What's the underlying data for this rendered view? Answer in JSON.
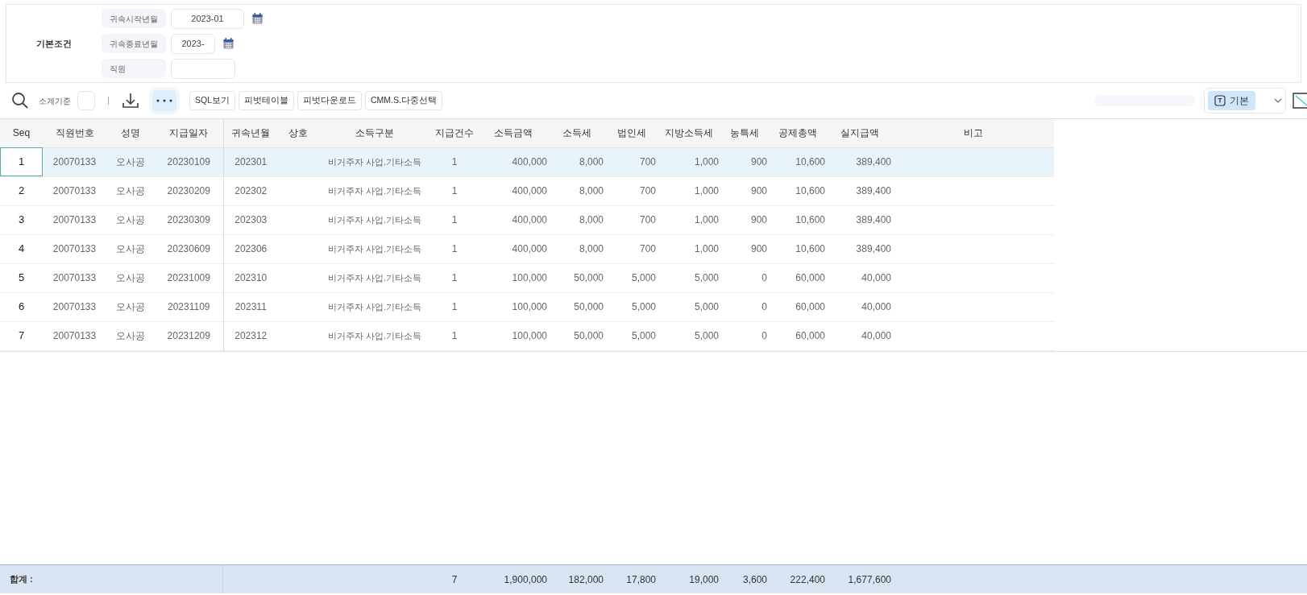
{
  "filter_panel": {
    "title": "기본조건",
    "fields": [
      {
        "label": "귀속시작년월",
        "value": "2023-01",
        "kind": "month"
      },
      {
        "label": "귀속종료년월",
        "value": "2023-",
        "kind": "month"
      },
      {
        "label": "직원",
        "kind": "text"
      }
    ]
  },
  "toolbar": {
    "subtotal_label": "소계기준",
    "subtotal_checked": false,
    "more_selected": true,
    "buttons": [
      "SQL보기",
      "피벗테이블",
      "피벗다운로드",
      "CMM.S.다중선택"
    ],
    "view_select": "기본"
  },
  "table": {
    "columns": [
      "Seq",
      "직원번호",
      "성명",
      "지급일자",
      "귀속년월",
      "상호",
      "소득구분",
      "지급건수",
      "소득금액",
      "소득세",
      "법인세",
      "지방소득세",
      "농특세",
      "공제총액",
      "실지급액",
      "비고"
    ],
    "rows": [
      {
        "selected": true,
        "cells": [
          "1",
          "20070133",
          "오사공",
          "20230109",
          "202301",
          null,
          "비거주자 사업.기타소득",
          "1",
          "400,000",
          "8,000",
          "700",
          "1,000",
          "900",
          "10,600",
          "389,400",
          null
        ]
      },
      {
        "selected": false,
        "cells": [
          "2",
          "20070133",
          "오사공",
          "20230209",
          "202302",
          null,
          "비거주자 사업.기타소득",
          "1",
          "400,000",
          "8,000",
          "700",
          "1,000",
          "900",
          "10,600",
          "389,400",
          null
        ]
      },
      {
        "selected": false,
        "cells": [
          "3",
          "20070133",
          "오사공",
          "20230309",
          "202303",
          null,
          "비거주자 사업.기타소득",
          "1",
          "400,000",
          "8,000",
          "700",
          "1,000",
          "900",
          "10,600",
          "389,400",
          null
        ]
      },
      {
        "selected": false,
        "cells": [
          "4",
          "20070133",
          "오사공",
          "20230609",
          "202306",
          null,
          "비거주자 사업.기타소득",
          "1",
          "400,000",
          "8,000",
          "700",
          "1,000",
          "900",
          "10,600",
          "389,400",
          null
        ]
      },
      {
        "selected": false,
        "cells": [
          "5",
          "20070133",
          "오사공",
          "20231009",
          "202310",
          null,
          "비거주자 사업.기타소득",
          "1",
          "100,000",
          "50,000",
          "5,000",
          "5,000",
          "0",
          "60,000",
          "40,000",
          null
        ]
      },
      {
        "selected": false,
        "cells": [
          "6",
          "20070133",
          "오사공",
          "20231109",
          "202311",
          null,
          "비거주자 사업.기타소득",
          "1",
          "100,000",
          "50,000",
          "5,000",
          "5,000",
          "0",
          "60,000",
          "40,000",
          null
        ]
      },
      {
        "selected": false,
        "cells": [
          "7",
          "20070133",
          "오사공",
          "20231209",
          "202312",
          null,
          "비거주자 사업.기타소득",
          "1",
          "100,000",
          "50,000",
          "5,000",
          "5,000",
          "0",
          "60,000",
          "40,000",
          null
        ]
      }
    ],
    "footer": {
      "label": "합계 :",
      "cells": [
        null,
        null,
        null,
        null,
        null,
        null,
        null,
        "7",
        "1,900,000",
        "182,000",
        "17,800",
        "19,000",
        "3,600",
        "222,400",
        "1,677,600",
        null
      ]
    }
  }
}
